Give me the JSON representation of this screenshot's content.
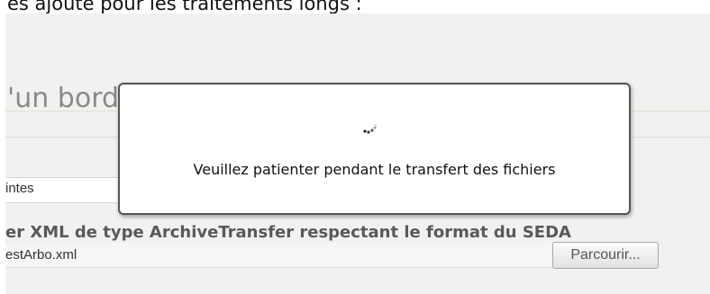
{
  "caption": {
    "text": "es ajouté pour les traitements longs :"
  },
  "form": {
    "heading": "'un borde",
    "contents_value": "intes",
    "file_label": "er XML de type ArchiveTransfer respectant le format du SEDA",
    "file_value": "estArbo.xml",
    "browse_label": "Parcourir..."
  },
  "modal": {
    "message": "Veuillez patienter pendant le transfert des fichiers",
    "icon": "loading-spinner-icon"
  },
  "colors": {
    "panel_background": "#f1f1f1",
    "heading_text": "#8a8a8a",
    "heading_rule": "#e3e6b8",
    "modal_border": "#555555"
  }
}
